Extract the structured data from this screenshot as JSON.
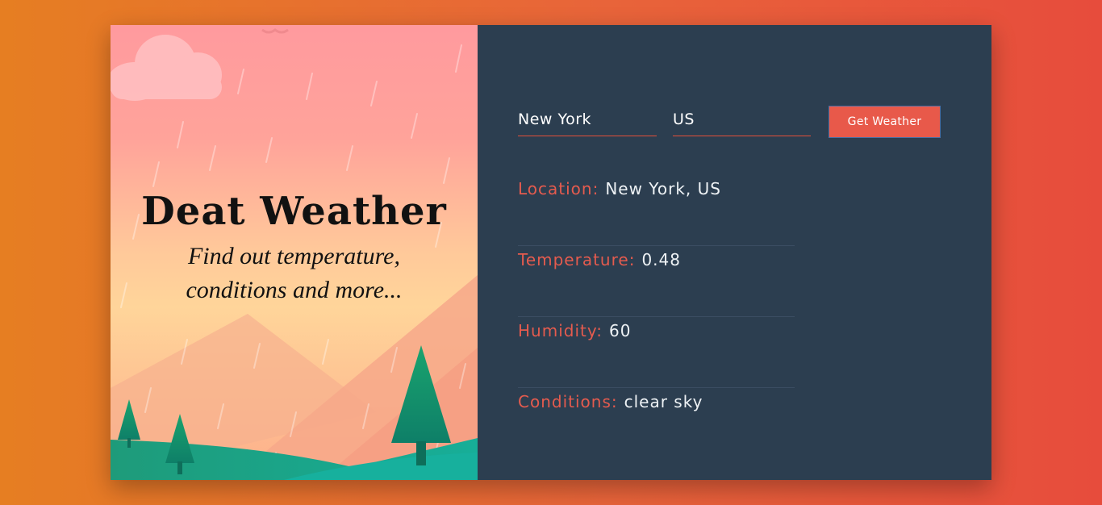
{
  "hero": {
    "title": "Deat Weather",
    "subtitle_line1": "Find out temperature,",
    "subtitle_line2": "conditions and more..."
  },
  "form": {
    "city_value": "New York",
    "country_value": "US",
    "submit_label": "Get Weather"
  },
  "results": [
    {
      "label": "Location:",
      "value": "New York, US"
    },
    {
      "label": "Temperature:",
      "value": "0.48"
    },
    {
      "label": "Humidity:",
      "value": "60"
    },
    {
      "label": "Conditions:",
      "value": "clear sky"
    }
  ],
  "colors": {
    "accent": "#e55b4e",
    "panel": "#2c3e50",
    "tree": "#16a085"
  }
}
